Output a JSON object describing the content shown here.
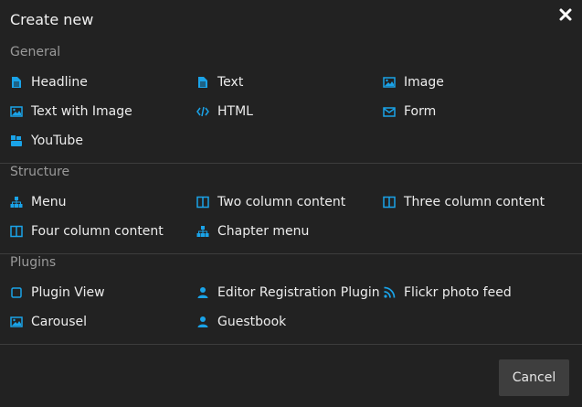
{
  "dialog": {
    "title": "Create new",
    "cancel_label": "Cancel",
    "accent_color": "#1aa3e8"
  },
  "sections": [
    {
      "title": "General",
      "items": [
        {
          "label": "Headline",
          "icon": "file-text-icon"
        },
        {
          "label": "Text",
          "icon": "file-text-icon"
        },
        {
          "label": "Image",
          "icon": "image-icon"
        },
        {
          "label": "Text with Image",
          "icon": "image-icon"
        },
        {
          "label": "HTML",
          "icon": "code-icon"
        },
        {
          "label": "Form",
          "icon": "envelope-icon"
        },
        {
          "label": "YouTube",
          "icon": "youtube-icon"
        }
      ]
    },
    {
      "title": "Structure",
      "items": [
        {
          "label": "Menu",
          "icon": "sitemap-icon"
        },
        {
          "label": "Two column content",
          "icon": "columns-icon"
        },
        {
          "label": "Three column content",
          "icon": "columns-icon"
        },
        {
          "label": "Four column content",
          "icon": "columns-icon"
        },
        {
          "label": "Chapter menu",
          "icon": "sitemap-icon"
        }
      ]
    },
    {
      "title": "Plugins",
      "items": [
        {
          "label": "Plugin View",
          "icon": "square-outline-icon"
        },
        {
          "label": "Editor Registration Plugin",
          "icon": "user-icon"
        },
        {
          "label": "Flickr photo feed",
          "icon": "rss-icon"
        },
        {
          "label": "Carousel",
          "icon": "image-icon"
        },
        {
          "label": "Guestbook",
          "icon": "user-icon"
        }
      ]
    }
  ]
}
